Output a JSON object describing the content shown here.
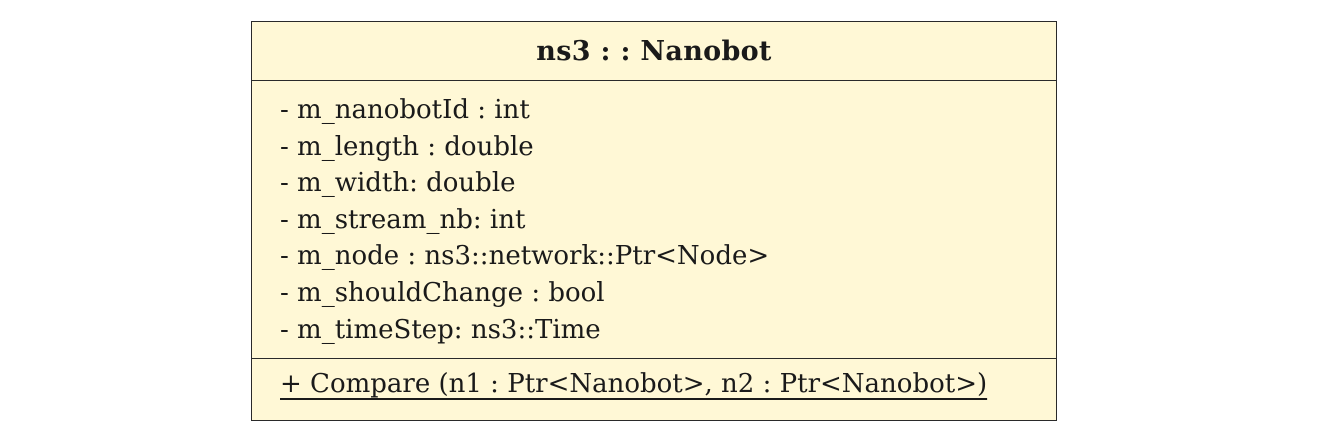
{
  "uml_class": {
    "name": "ns3 : : Nanobot",
    "attributes": [
      "- m_nanobotId : int",
      "- m_length : double",
      "- m_width: double",
      "- m_stream_nb: int",
      "- m_node : ns3::network::Ptr<Node>",
      "- m_shouldChange : bool",
      "- m_timeStep: ns3::Time"
    ],
    "operations": [
      "+ Compare (n1 : Ptr<Nanobot>, n2 : Ptr<Nanobot>)"
    ],
    "fill_color": "#fff8d6",
    "border_color": "#2a2a2a"
  }
}
